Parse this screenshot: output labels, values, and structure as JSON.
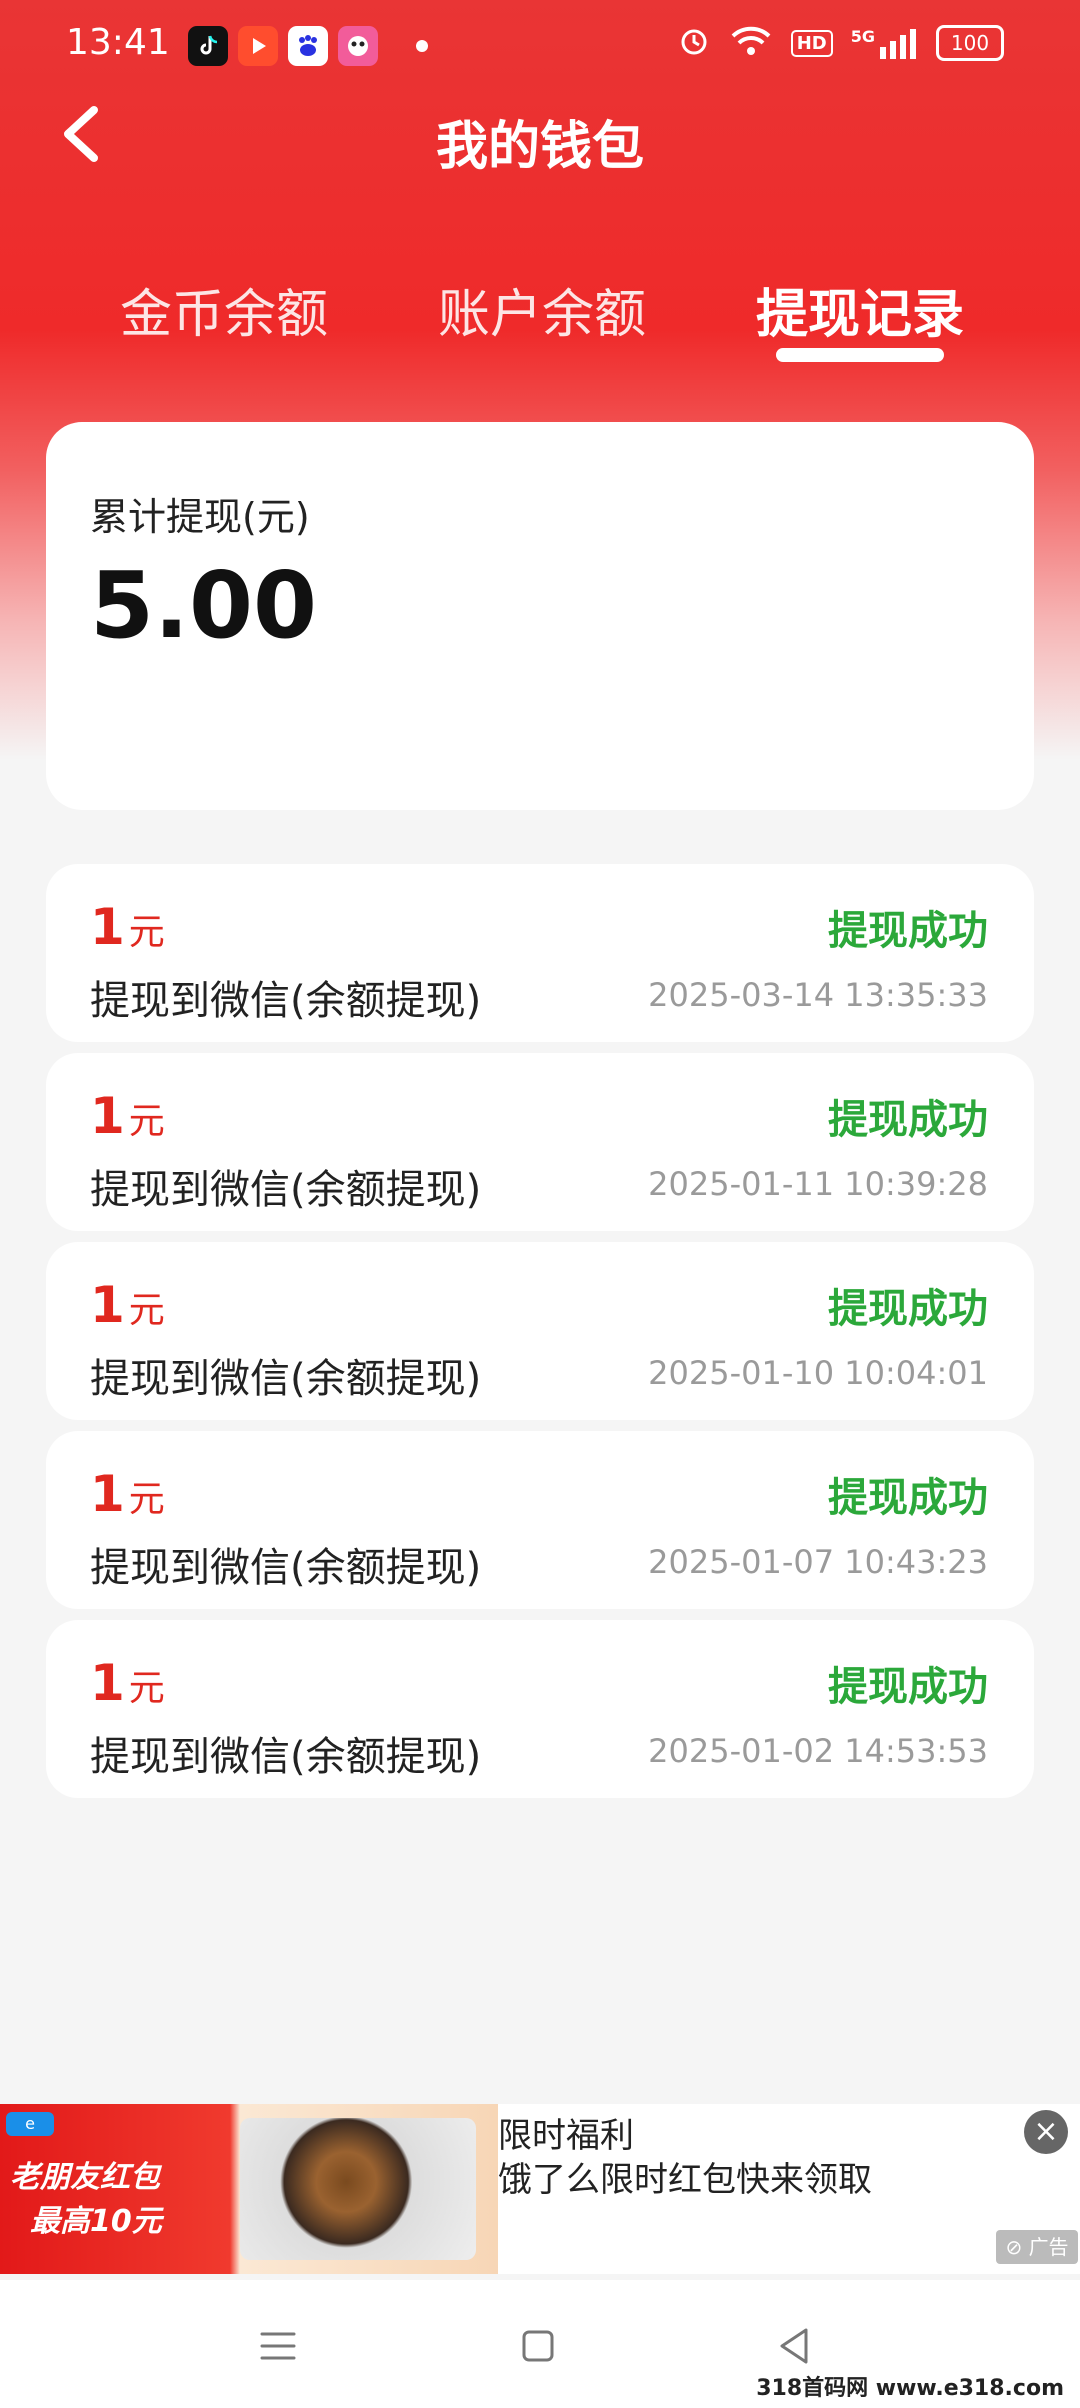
{
  "status_bar": {
    "time": "13:41",
    "network": "5G",
    "hd_badge": "HD",
    "battery": "100",
    "app_icons": [
      "tiktok-icon",
      "video-app-icon",
      "baidu-icon",
      "game-app-icon"
    ]
  },
  "header": {
    "title": "我的钱包",
    "back_icon": "chevron-left-icon"
  },
  "tabs": [
    {
      "label": "金币余额",
      "active": false
    },
    {
      "label": "账户余额",
      "active": false
    },
    {
      "label": "提现记录",
      "active": true
    }
  ],
  "summary": {
    "label": "累计提现(元)",
    "value": "5.00"
  },
  "records": [
    {
      "amount": "1",
      "unit": "元",
      "description": "提现到微信(余额提现)",
      "status": "提现成功",
      "date": "2025-03-14 13:35:33"
    },
    {
      "amount": "1",
      "unit": "元",
      "description": "提现到微信(余额提现)",
      "status": "提现成功",
      "date": "2025-01-11 10:39:28"
    },
    {
      "amount": "1",
      "unit": "元",
      "description": "提现到微信(余额提现)",
      "status": "提现成功",
      "date": "2025-01-10 10:04:01"
    },
    {
      "amount": "1",
      "unit": "元",
      "description": "提现到微信(余额提现)",
      "status": "提现成功",
      "date": "2025-01-07 10:43:23"
    },
    {
      "amount": "1",
      "unit": "元",
      "description": "提现到微信(余额提现)",
      "status": "提现成功",
      "date": "2025-01-02 14:53:53"
    }
  ],
  "ad": {
    "promo_line1": "老朋友红包",
    "promo_line2": "最高10元",
    "title": "限时福利",
    "subtitle": "饿了么限时红包快来领取",
    "close": "×",
    "tag": "广告"
  },
  "watermark": "318首码网 www.e318.com",
  "colors": {
    "header_red": "#ef2a2a",
    "amount_red": "#e0281f",
    "success_green": "#2ba83a",
    "date_gray": "#9a9a9a"
  }
}
